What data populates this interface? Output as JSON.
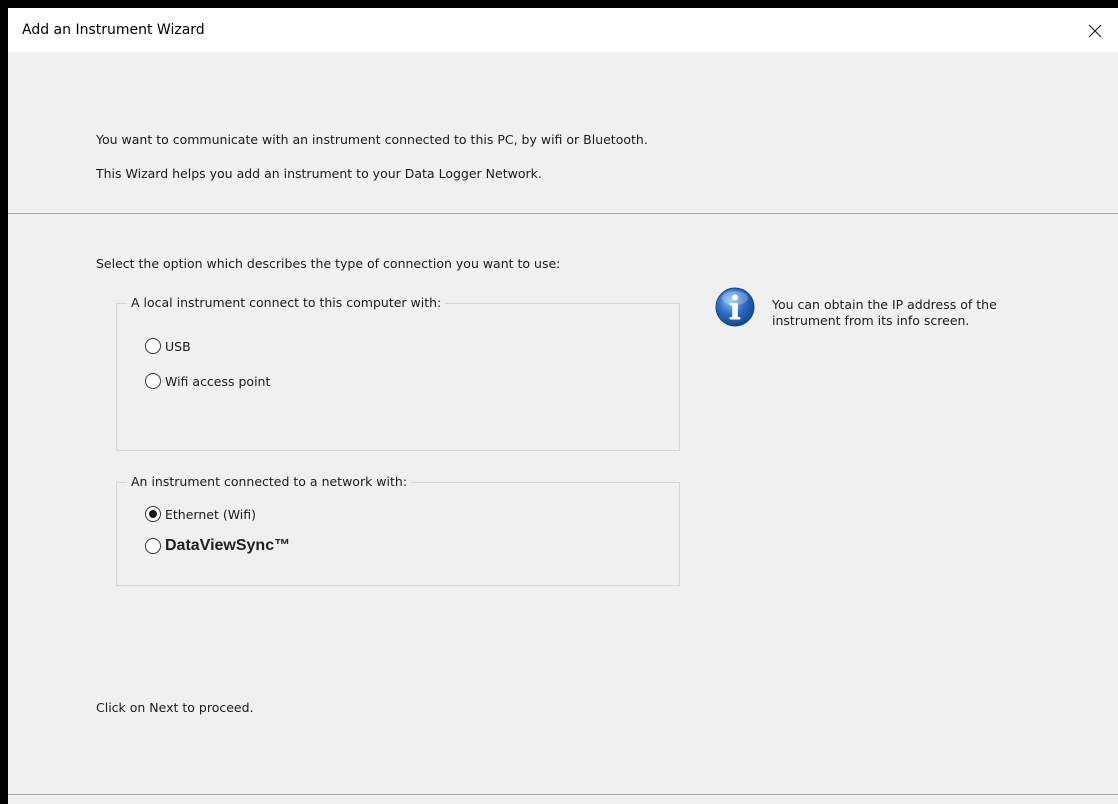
{
  "window": {
    "title": "Add an Instrument Wizard",
    "close_icon": "close-icon"
  },
  "intro": {
    "line1": "You want to communicate with an instrument connected to this PC, by wifi or Bluetooth.",
    "line2": "This Wizard helps you add an instrument to your Data Logger Network."
  },
  "select_prompt": "Select the option which describes the type of connection you want to use:",
  "local_group": {
    "legend": "A local instrument connect to this computer with:",
    "options": [
      {
        "label": "USB",
        "checked": false
      },
      {
        "label": "Wifi access point",
        "checked": false
      }
    ]
  },
  "network_group": {
    "legend": "An instrument connected to a network with:",
    "options": [
      {
        "label": "Ethernet (Wifi)",
        "checked": true
      },
      {
        "label": "DataViewSync™",
        "checked": false
      }
    ]
  },
  "info": {
    "icon": "info-icon",
    "line1": "You can obtain the IP address of the",
    "line2": "instrument from its info screen."
  },
  "proceed_text": "Click on Next to proceed.",
  "colors": {
    "dialog_background": "#f0f0f0",
    "title_background": "#ffffff",
    "info_icon_blue": "#2a6bc4"
  }
}
